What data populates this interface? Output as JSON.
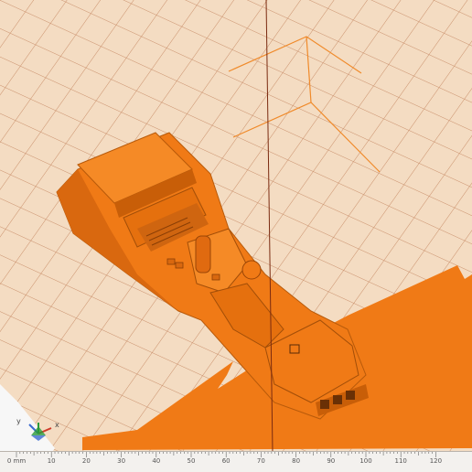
{
  "viewport": {
    "grid_color": "#c98f6b",
    "model_color": "#f07a16",
    "model_shadow": "#c85e08",
    "model_highlight": "#ff9a3e",
    "background": "#f4dcc2",
    "cursor_line_color": "#7a2a10"
  },
  "axis_gizmo": {
    "y_label": "y",
    "x_label": "x",
    "x_color": "#d03a2a",
    "y_color": "#3a6ad0",
    "z_color": "#2a9a3a"
  },
  "ruler": {
    "unit_label": "0 mm",
    "ticks": [
      "10",
      "20",
      "30",
      "40",
      "50",
      "60",
      "70",
      "80",
      "90",
      "100",
      "110",
      "120"
    ]
  }
}
